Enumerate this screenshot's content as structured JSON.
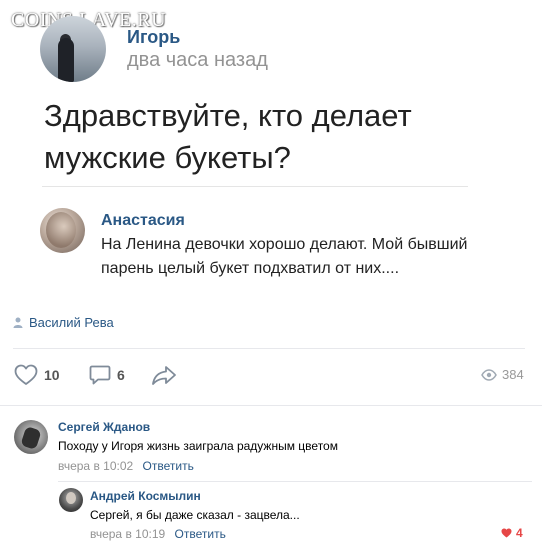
{
  "watermark": "COINS.LAVE.RU",
  "post": {
    "author": "Игорь",
    "time": "два часа назад",
    "text": "Здравствуйте, кто делает мужские букеты?"
  },
  "embedded_comment": {
    "author": "Анастасия",
    "text": "На Ленина девочки хорошо делают. Мой бывший парень целый букет подхватил от них...."
  },
  "repost_user": "Василий Рева",
  "actions": {
    "likes": "10",
    "comments": "6",
    "views": "384"
  },
  "comments": [
    {
      "author": "Сергей Жданов",
      "text": "Походу у Игоря жизнь заиграла радужным цветом",
      "time": "вчера в 10:02",
      "reply_label": "Ответить"
    },
    {
      "author": "Андрей Космылин",
      "text": "Сергей, я бы даже сказал - зацвела...",
      "time": "вчера в 10:19",
      "reply_label": "Ответить",
      "likes": "4"
    }
  ],
  "colors": {
    "link": "#2a5885",
    "muted": "#939393",
    "like_active": "#e64646"
  },
  "icons": [
    "user-icon",
    "heart-icon",
    "comment-icon",
    "share-icon",
    "eye-icon",
    "heart-filled-icon"
  ]
}
